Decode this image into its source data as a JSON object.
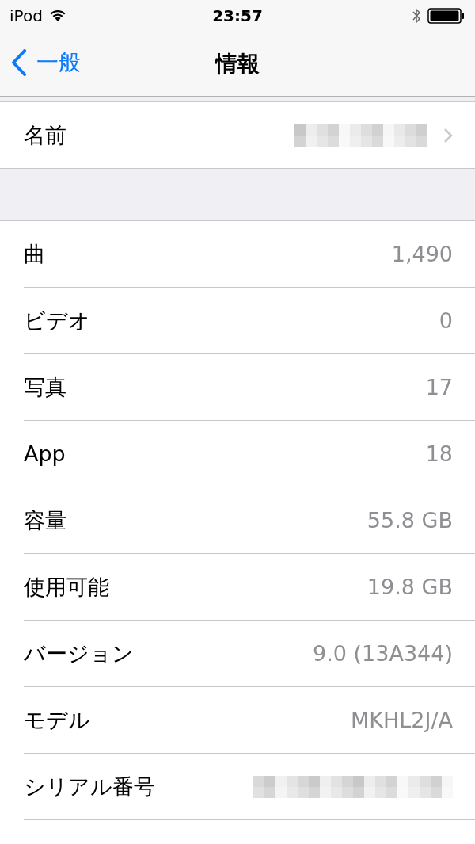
{
  "status_bar": {
    "carrier": "iPod",
    "time": "23:57",
    "bluetooth": true
  },
  "nav": {
    "back": "一般",
    "title": "情報"
  },
  "groups": [
    {
      "rows": [
        {
          "kind": "redacted",
          "label": "名前",
          "chevron": true
        }
      ]
    },
    {
      "rows": [
        {
          "kind": "value",
          "label": "曲",
          "value": "1,490"
        },
        {
          "kind": "value",
          "label": "ビデオ",
          "value": "0"
        },
        {
          "kind": "value",
          "label": "写真",
          "value": "17"
        },
        {
          "kind": "value",
          "label": "App",
          "value": "18"
        },
        {
          "kind": "value",
          "label": "容量",
          "value": "55.8 GB"
        },
        {
          "kind": "value",
          "label": "使用可能",
          "value": "19.8 GB"
        },
        {
          "kind": "value",
          "label": "バージョン",
          "value": "9.0 (13A344)"
        },
        {
          "kind": "value",
          "label": "モデル",
          "value": "MKHL2J/A"
        },
        {
          "kind": "redacted",
          "label": "シリアル番号",
          "chevron": false
        }
      ]
    }
  ]
}
